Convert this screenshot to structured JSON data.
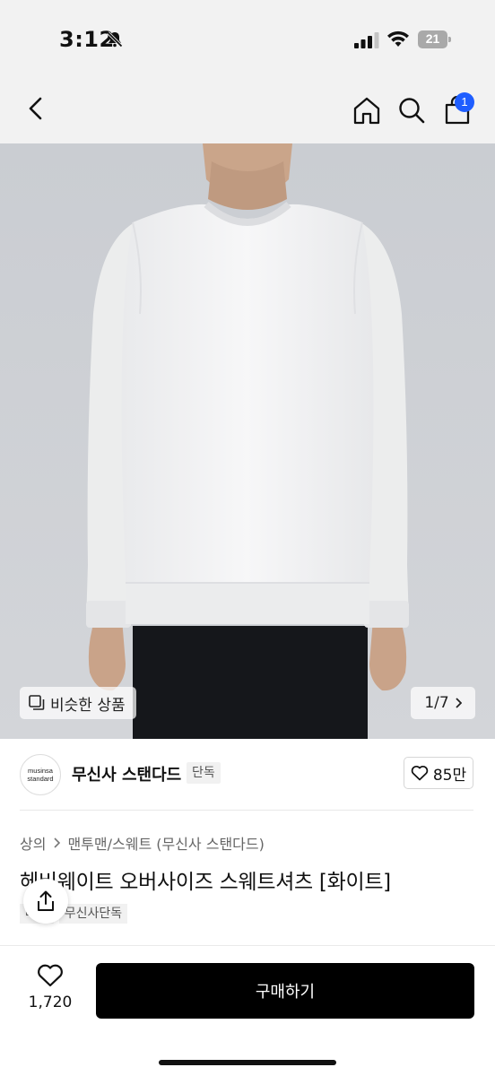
{
  "status_bar": {
    "time": "3:12",
    "battery_level": "21",
    "icons": [
      "bell-off-icon",
      "signal-icon",
      "wifi-icon",
      "battery-icon"
    ]
  },
  "nav": {
    "icons": [
      "back-chevron-icon",
      "home-icon",
      "search-icon",
      "shopping-bag-icon"
    ],
    "cart_count": "1",
    "accent_color": "#1f5eff"
  },
  "gallery": {
    "similar_label": "비슷한 상품",
    "counter": "1/7",
    "current_index": 1,
    "total": 7
  },
  "brand": {
    "logo_line1": "musinsa",
    "logo_line2": "standard",
    "name": "무신사 스탠다드",
    "tag": "단독",
    "likes": "85만"
  },
  "breadcrumb": {
    "level1": "상의",
    "level2": "맨투맨/스웨트 (무신사 스탠다드)"
  },
  "product": {
    "title": "헤비웨이트 오버사이즈 스웨트셔츠 [화이트]",
    "tags": [
      "배송",
      "무신사단독"
    ]
  },
  "bottom_bar": {
    "like_count": "1,720",
    "buy_label": "구매하기"
  }
}
